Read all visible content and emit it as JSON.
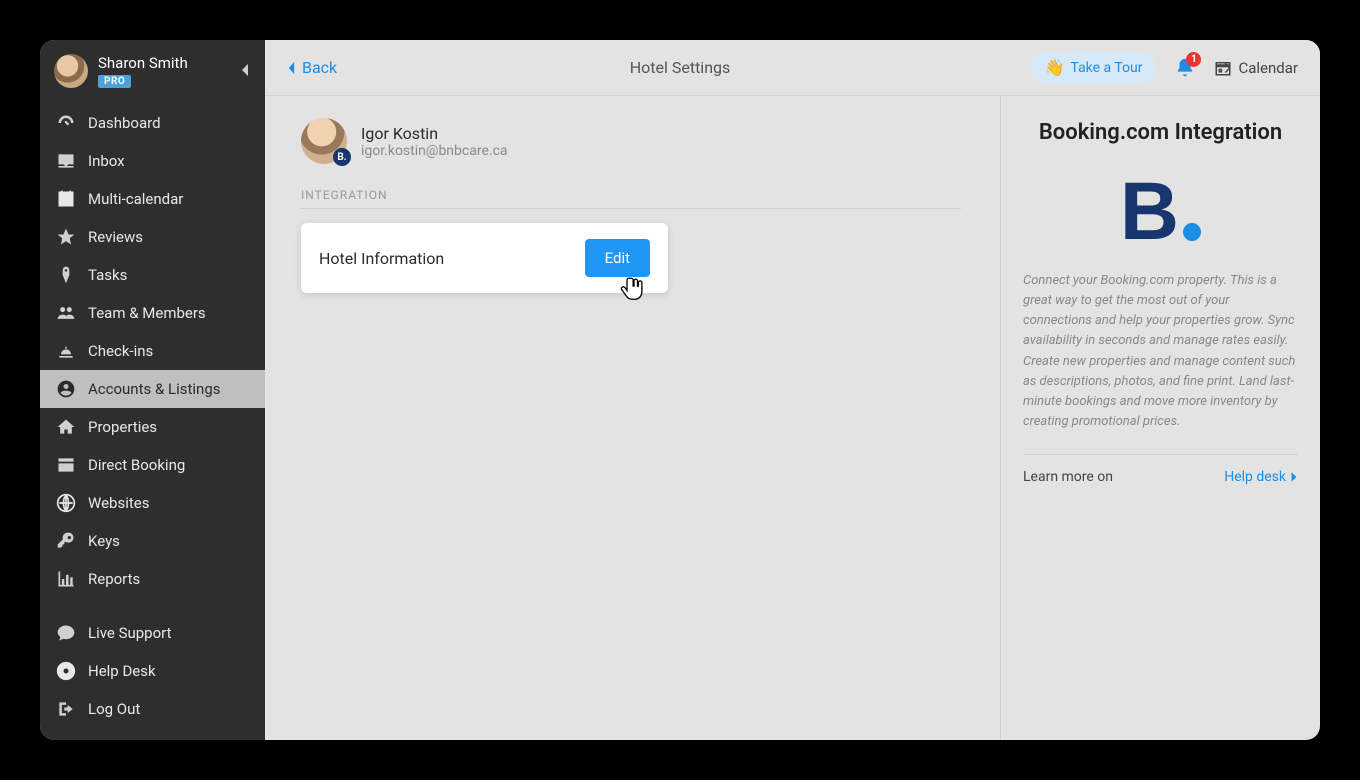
{
  "profile": {
    "name": "Sharon Smith",
    "badge": "PRO"
  },
  "sidebar": {
    "items": [
      {
        "label": "Dashboard",
        "icon": "gauge"
      },
      {
        "label": "Inbox",
        "icon": "tray"
      },
      {
        "label": "Multi-calendar",
        "icon": "calendar"
      },
      {
        "label": "Reviews",
        "icon": "star"
      },
      {
        "label": "Tasks",
        "icon": "tag"
      },
      {
        "label": "Team & Members",
        "icon": "users"
      },
      {
        "label": "Check-ins",
        "icon": "bell-desk"
      },
      {
        "label": "Accounts & Listings",
        "icon": "circle-user",
        "active": true
      },
      {
        "label": "Properties",
        "icon": "home"
      },
      {
        "label": "Direct Booking",
        "icon": "booking"
      },
      {
        "label": "Websites",
        "icon": "globe"
      },
      {
        "label": "Keys",
        "icon": "key"
      },
      {
        "label": "Reports",
        "icon": "chart"
      }
    ],
    "footer": [
      {
        "label": "Live Support",
        "icon": "chat"
      },
      {
        "label": "Help Desk",
        "icon": "lifebuoy"
      },
      {
        "label": "Log Out",
        "icon": "logout"
      }
    ]
  },
  "topbar": {
    "back": "Back",
    "title": "Hotel Settings",
    "tour": "Take a Tour",
    "badge": "1",
    "calendar": "Calendar"
  },
  "user": {
    "name": "Igor Kostin",
    "email": "igor.kostin@bnbcare.ca",
    "badge": "B."
  },
  "section_label": "INTEGRATION",
  "card": {
    "title": "Hotel Information",
    "edit": "Edit"
  },
  "right": {
    "title": "Booking.com Integration",
    "desc": "Connect your Booking.com property. This is a great way to get the most out of your connections and help your properties grow. Sync availability in seconds and manage rates easily. Create new properties and manage content such as descriptions, photos, and fine print. Land last-minute bookings and move more inventory by creating promotional prices.",
    "learn": "Learn more on",
    "link": "Help desk"
  }
}
